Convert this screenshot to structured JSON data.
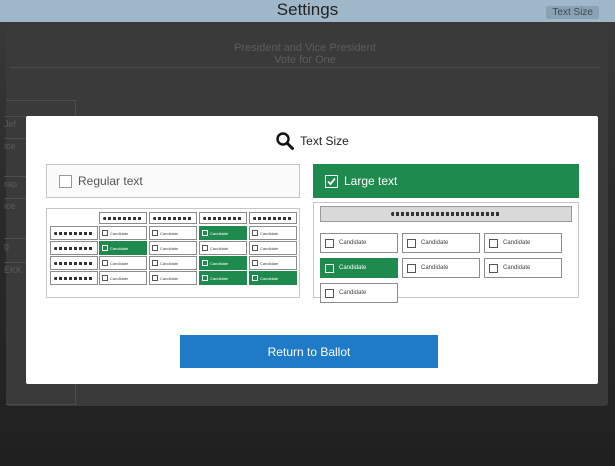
{
  "window": {
    "title": "Settings",
    "corner_text": "Text Size"
  },
  "ballot": {
    "contest_title": "President and Vice President",
    "contest_instruction": "Vote for One",
    "side_labels": [
      "Jef",
      "ice",
      "rap",
      "ice",
      "g",
      "EKK"
    ]
  },
  "modal": {
    "title": "Text Size",
    "options": {
      "regular_label": "Regular text",
      "large_label": "Large text",
      "selected": "large"
    },
    "preview_small": {
      "cell_label": "Candidate"
    },
    "preview_large": {
      "cell_label": "Candidate"
    },
    "return_button": "Return to Ballot"
  },
  "icons": {
    "title_icon": "magnifier-icon",
    "checked_icon": "checkmark-icon"
  },
  "colors": {
    "accent_green": "#1f8a4e",
    "button_blue": "#1f7bc8",
    "topbar": "#9fb8c9"
  }
}
